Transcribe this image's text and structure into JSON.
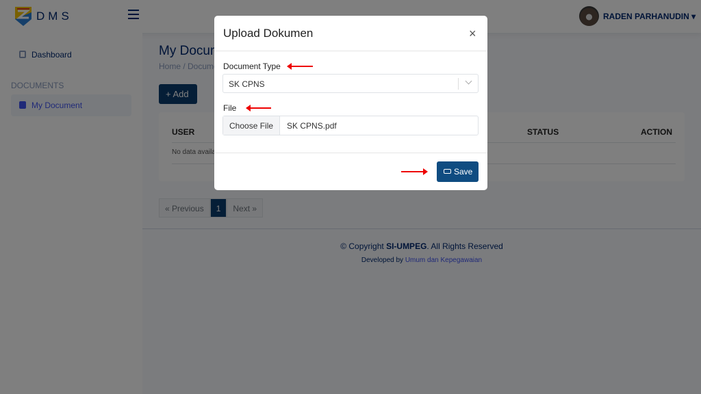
{
  "header": {
    "brand": "DMS",
    "user_name": "RADEN PARHANUDIN"
  },
  "sidebar": {
    "dashboard": "Dashboard",
    "section": "DOCUMENTS",
    "my_document": "My Document"
  },
  "main": {
    "title": "My Document",
    "breadcrumb": "Home / Document",
    "add_label": "+ Add",
    "table": {
      "headers": [
        "USER",
        "STATUS",
        "ACTION"
      ],
      "empty": "No data available"
    },
    "pagination": {
      "previous": "« Previous",
      "current": "1",
      "next": "Next »"
    }
  },
  "footer": {
    "copyright_prefix": "© Copyright ",
    "copyright_brand": "SI-UMPEG",
    "copyright_suffix": ". All Rights Reserved",
    "developed_prefix": "Developed by ",
    "developer": "Umum dan Kepegawaian"
  },
  "modal": {
    "title": "Upload Dokumen",
    "close": "×",
    "document_type_label": "Document Type",
    "document_type_value": "SK CPNS",
    "file_label": "File",
    "choose_file": "Choose File",
    "file_name": "SK CPNS.pdf",
    "save_label": "Save"
  },
  "colors": {
    "primary": "#0f4c81",
    "brand": "#012970",
    "annotation_arrow": "#e00000"
  }
}
